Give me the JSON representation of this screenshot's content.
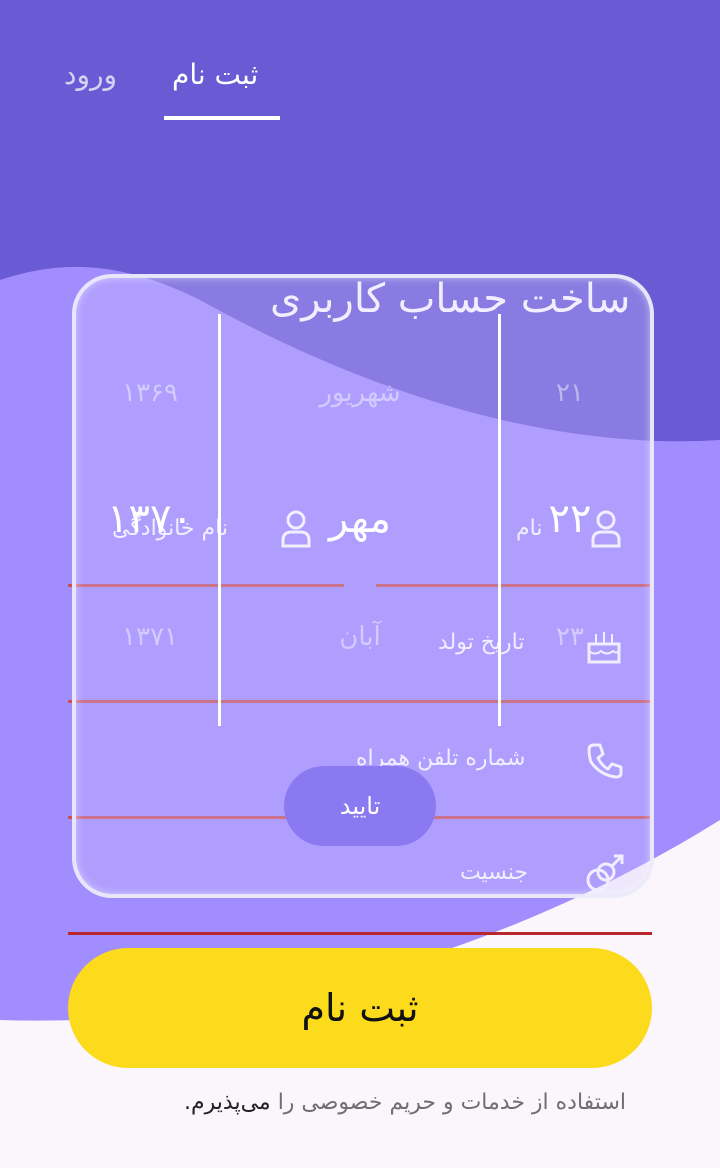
{
  "colors": {
    "primary": "#6a5bd4",
    "secondary": "#a08cff",
    "button_yellow": "#fbdb1c",
    "divider_red": "#c9505a"
  },
  "tabs": {
    "register": "ثبت نام",
    "login": "ورود"
  },
  "title": "ساخت حساب کاربری",
  "form": {
    "first_name_placeholder": "نام",
    "last_name_placeholder": "نام خانوادگی",
    "birth_date_label": "تاریخ تولد",
    "phone_label": "شماره تلفن همراه",
    "gender_label": "جنسیت"
  },
  "picker": {
    "day": {
      "prev": "۲۱",
      "current": "۲۲",
      "next": "۲۳"
    },
    "month": {
      "prev": "شهریور",
      "current": "مهر",
      "next": "آبان"
    },
    "year": {
      "prev": "۱۳۶۹",
      "current": "۱۳۷۰",
      "next": "۱۳۷۱"
    },
    "confirm_label": "تایید"
  },
  "register_button_label": "ثبت نام",
  "terms": {
    "text": "استفاده از خدمات و حریم خصوصی را",
    "accent": "می‌پذیرم."
  },
  "icons": [
    "person-icon",
    "cake-icon",
    "phone-icon",
    "gender-icon"
  ]
}
